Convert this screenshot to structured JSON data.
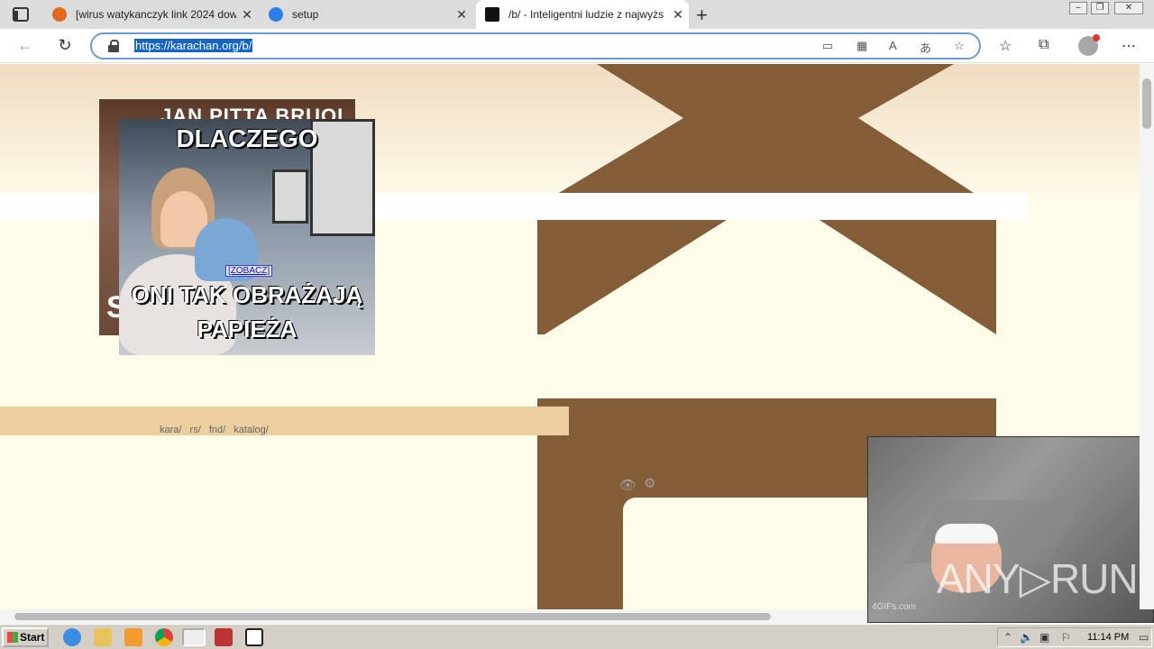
{
  "browser": {
    "tabs": [
      {
        "title": "[wirus watykanczyk link 2024 dow",
        "icon": "orange-app-icon",
        "active": false
      },
      {
        "title": "setup",
        "icon": "edge-blue-icon",
        "active": false
      },
      {
        "title": "/b/ - Inteligentni ludzie z najwyżs",
        "icon": "karachan-icon",
        "active": true
      }
    ],
    "new_tab": "+",
    "url": "https://karachan.org/b/"
  },
  "page": {
    "board_links": [
      "kara/",
      "rs/",
      "fnd/",
      "katalog/"
    ],
    "meme_back": {
      "top_caption": "JAN PITTA BRUOL",
      "side_text": "S"
    },
    "meme_front": {
      "top_caption": "DLACZEGO",
      "bottom_caption_1": "ONI TAK OBRAŻAJĄ",
      "bottom_caption_2": "PAPIEŻA",
      "link_text": "[ZOBACZ]"
    },
    "gif_overlay": {
      "brand": "ANY▷RUN",
      "watermark": "4GIFs.com"
    }
  },
  "taskbar": {
    "start_label": "Start",
    "clock": "11:14 PM"
  },
  "colors": {
    "accent_brown": "#835c38",
    "nav_tan": "#edcf9f",
    "page_bg": "#fefbe8"
  }
}
